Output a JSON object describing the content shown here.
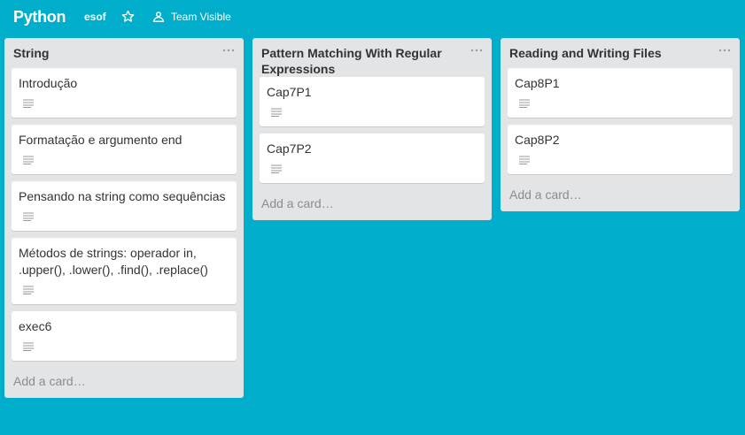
{
  "board": {
    "title": "Python",
    "org": "esof",
    "visibility": "Team Visible",
    "star_icon": "star-icon",
    "visibility_icon": "team-icon"
  },
  "lists": [
    {
      "title": "String",
      "menu_icon": "ellipsis-icon",
      "cards": [
        {
          "title": "Introdução",
          "badge_icon": "description-icon"
        },
        {
          "title": "Formatação e argumento end",
          "badge_icon": "description-icon"
        },
        {
          "title": "Pensando na string como sequências",
          "badge_icon": "description-icon"
        },
        {
          "title": "Métodos de strings: operador in, .upper(), .lower(), .find(), .replace()",
          "badge_icon": "description-icon"
        },
        {
          "title": "exec6",
          "badge_icon": "description-icon"
        }
      ],
      "add_card": "Add a card…"
    },
    {
      "title": "Pattern Matching With Regular Expressions",
      "menu_icon": "ellipsis-icon",
      "cards": [
        {
          "title": "Cap7P1",
          "badge_icon": "description-icon"
        },
        {
          "title": "Cap7P2",
          "badge_icon": "description-icon"
        }
      ],
      "add_card": "Add a card…"
    },
    {
      "title": "Reading and Writing Files",
      "menu_icon": "ellipsis-icon",
      "cards": [
        {
          "title": "Cap8P1",
          "badge_icon": "description-icon"
        },
        {
          "title": "Cap8P2",
          "badge_icon": "description-icon"
        }
      ],
      "add_card": "Add a card…"
    }
  ],
  "colors": {
    "board_background": "#00aecc",
    "list_background": "#e2e4e6",
    "card_background": "#ffffff",
    "card_text": "#333333",
    "add_card_text": "#8c8c8c"
  }
}
